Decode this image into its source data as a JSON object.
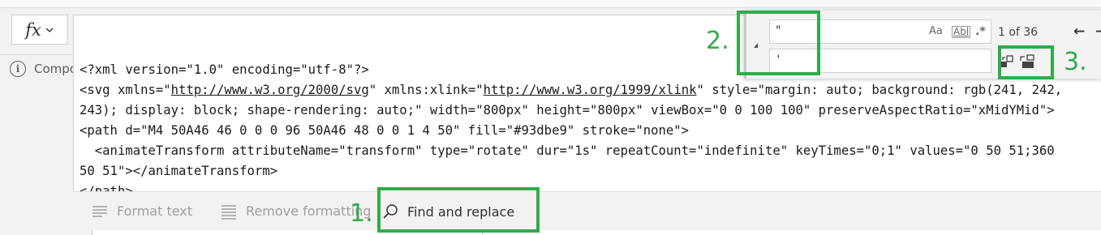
{
  "formula_bar": {
    "fx_label": "fx",
    "info_text": "Compo"
  },
  "code": {
    "line1": "<?xml version=\"1.0\" encoding=\"utf-8\"?>",
    "line2_a": "<svg xmlns=\"",
    "line2_link1": "http://www.w3.org/2000/svg",
    "line2_b": "\" xmlns:xlink=\"",
    "line2_link2": "http://www.w3.org/1999/xlink",
    "line2_c": "\" style=\"margin: auto; background: rgb(241, 242,",
    "line3": "243); display: block; shape-rendering: auto;\" width=\"800px\" height=\"800px\" viewBox=\"0 0 100 100\" preserveAspectRatio=\"xMidYMid\">",
    "line4": "<path d=\"M4 50A46 46 0 0 0 96 50A46 48 0 0 1 4 50\" fill=\"#93dbe9\" stroke=\"none\">",
    "line5": "  <animateTransform attributeName=\"transform\" type=\"rotate\" dur=\"1s\" repeatCount=\"indefinite\" keyTimes=\"0;1\" values=\"0 50 51;360",
    "line6": "50 51\"></animateTransform>",
    "line7": "</path>"
  },
  "toolbar": {
    "format_text": "Format text",
    "remove_formatting": "Remove formatting",
    "find_and_replace": "Find and replace"
  },
  "find_widget": {
    "find_value": "\"",
    "replace_value": "'",
    "match_case": "Aa",
    "whole_word": "Abl",
    "regex": ".*",
    "match_count": "1 of 36",
    "prev": "←",
    "next": "→"
  },
  "annotations": {
    "label1": "1.",
    "label2": "2.",
    "label3": "3."
  },
  "colors": {
    "annotation_green": "#2fac4b"
  }
}
